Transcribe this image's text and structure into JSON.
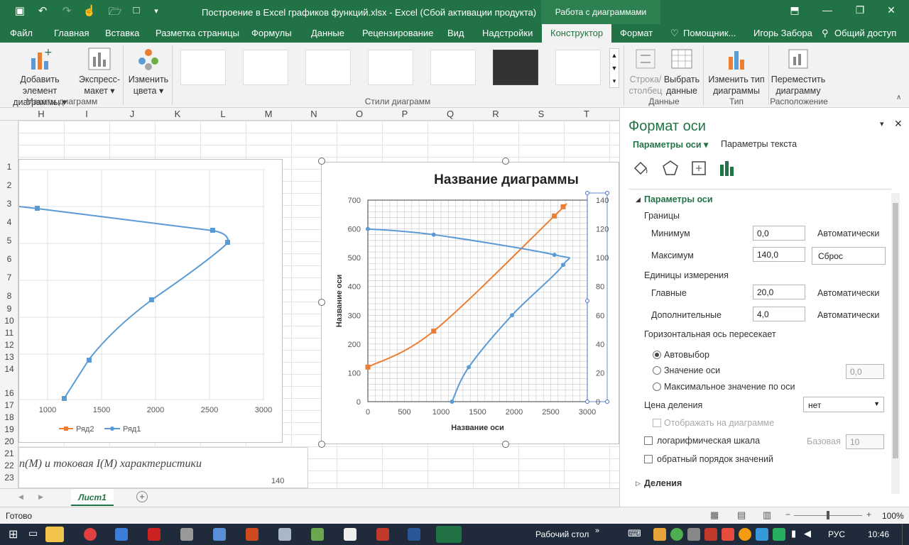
{
  "window": {
    "title": "Построение в Excel графиков функций.xlsx - Excel (Сбой активации продукта)",
    "context_title": "Работа с диаграммами"
  },
  "tabs": [
    "Файл",
    "Главная",
    "Вставка",
    "Разметка страницы",
    "Формулы",
    "Данные",
    "Рецензирование",
    "Вид",
    "Надстройки",
    "Конструктор",
    "Формат",
    "Помощник...",
    "Игорь Забора",
    "Общий доступ"
  ],
  "ribbon": {
    "add_element": [
      "Добавить элемент",
      "диаграммы"
    ],
    "express": [
      "Экспресс-",
      "макет"
    ],
    "group_layouts": "Макеты диаграмм",
    "colors": [
      "Изменить",
      "цвета"
    ],
    "group_styles": "Стили диаграмм",
    "row_col": [
      "Строка/",
      "столбец"
    ],
    "select_data": [
      "Выбрать",
      "данные"
    ],
    "group_data": "Данные",
    "change_type": [
      "Изменить тип",
      "диаграммы"
    ],
    "group_type": "Тип",
    "move": [
      "Переместить",
      "диаграмму"
    ],
    "group_location": "Расположение"
  },
  "sheet": {
    "columns": [
      "H",
      "I",
      "J",
      "K",
      "L",
      "M",
      "N",
      "O",
      "P",
      "Q",
      "R",
      "S",
      "T"
    ],
    "rows": [
      "1",
      "2",
      "3",
      "4",
      "5",
      "6",
      "7",
      "8",
      "9",
      "10",
      "11",
      "12",
      "13",
      "14",
      "16",
      "17",
      "18",
      "19",
      "20",
      "21",
      "22",
      "23"
    ],
    "caption": "n(M) и токовая  I(M) характеристики",
    "caption_axis": "140",
    "tab": "Лист1"
  },
  "chart_left": {
    "x_ticks": [
      "1000",
      "1500",
      "2000",
      "2500",
      "3000"
    ],
    "legend": [
      "Ряд2",
      "Ряд1"
    ]
  },
  "chart_data": {
    "type": "scatter",
    "title": "Название диаграммы",
    "xlabel": "Название оси",
    "ylabel": "Название оси",
    "xlim": [
      0,
      3000
    ],
    "ylim": [
      0,
      700
    ],
    "y2lim": [
      0,
      140
    ],
    "x_ticks": [
      "0",
      "500",
      "1000",
      "1500",
      "2000",
      "2500",
      "3000"
    ],
    "y_ticks": [
      "0",
      "100",
      "200",
      "300",
      "400",
      "500",
      "600",
      "700"
    ],
    "y2_ticks": [
      "0",
      "20",
      "40",
      "60",
      "80",
      "100",
      "120",
      "140"
    ],
    "grid": true,
    "series": [
      {
        "name": "Ряд2",
        "color": "#ed7d31",
        "axis": "primary",
        "x": [
          0,
          900,
          2550,
          2670
        ],
        "y": [
          120,
          245,
          645,
          677
        ]
      },
      {
        "name": "Ряд1",
        "color": "#5b9bd5",
        "axis": "secondary",
        "x": [
          0,
          900,
          2550,
          2670,
          1970,
          1380,
          1150
        ],
        "y": [
          120,
          116,
          102,
          95,
          60,
          24,
          0
        ]
      }
    ]
  },
  "pane": {
    "title": "Формат оси",
    "tab1": "Параметры оси",
    "tab2": "Параметры текста",
    "section": "Параметры оси",
    "bounds": "Границы",
    "min_label": "Минимум",
    "min_val": "0,0",
    "min_auto": "Автоматически",
    "max_label": "Максимум",
    "max_val": "140,0",
    "max_reset": "Сброс",
    "units": "Единицы измерения",
    "major_label": "Главные",
    "major_val": "20,0",
    "major_auto": "Автоматически",
    "minor_label": "Дополнительные",
    "minor_val": "4,0",
    "minor_auto": "Автоматически",
    "cross": "Горизонтальная ось пересекает",
    "r_auto": "Автовыбор",
    "r_value": "Значение оси",
    "r_value_val": "0,0",
    "r_max": "Максимальное значение по оси",
    "division": "Цена деления",
    "division_val": "нет",
    "show_on_chart": "Отображать на диаграмме",
    "log": "логарифмическая шкала",
    "base_label": "Базовая",
    "base_val": "10",
    "reverse": "обратный порядок значений",
    "divisions": "Деления"
  },
  "status": {
    "ready": "Готово",
    "zoom": "100%"
  },
  "taskbar": {
    "desktop": "Рабочий стол",
    "lang": "РУС",
    "time": "10:46"
  }
}
